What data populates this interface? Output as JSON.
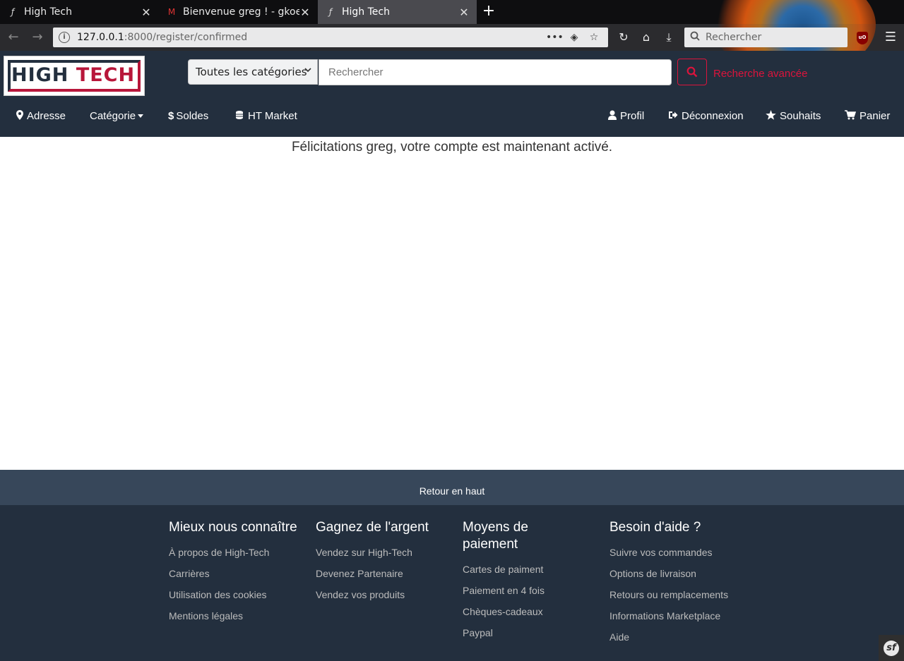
{
  "browser": {
    "tabs": [
      {
        "title": "High Tech",
        "active": false
      },
      {
        "title": "Bienvenue greg ! - gkoer",
        "active": false
      },
      {
        "title": "High Tech",
        "active": true
      }
    ],
    "url_host": "127.0.0.1",
    "url_rest": ":8000/register/confirmed",
    "search_placeholder": "Rechercher"
  },
  "header": {
    "logo_left": "HIGH",
    "logo_right": "TECH",
    "category_select": "Toutes les catégories",
    "search_placeholder": "Rechercher",
    "advanced_search": "Recherche avancée"
  },
  "nav": {
    "address": "Adresse",
    "category": "Catégorie",
    "sales": "Soldes",
    "market": "HT Market",
    "profile": "Profil",
    "logout": "Déconnexion",
    "wishlist": "Souhaits",
    "cart": "Panier"
  },
  "main": {
    "message": "Félicitations greg, votre compte est maintenant activé."
  },
  "footer": {
    "back_to_top": "Retour en haut",
    "columns": [
      {
        "title": "Mieux nous connaître",
        "links": [
          "À propos de High-Tech",
          "Carrières",
          "Utilisation des cookies",
          "Mentions légales"
        ]
      },
      {
        "title": "Gagnez de l'argent",
        "links": [
          "Vendez sur High-Tech",
          "Devenez Partenaire",
          "Vendez vos produits"
        ]
      },
      {
        "title": "Moyens de paiement",
        "links": [
          "Cartes de paiment",
          "Paiement en 4 fois",
          "Chèques-cadeaux",
          "Paypal"
        ]
      },
      {
        "title": "Besoin d'aide ?",
        "links": [
          "Suivre vos commandes",
          "Options de livraison",
          "Retours ou remplacements",
          "Informations Marketplace",
          "Aide"
        ]
      }
    ]
  },
  "colors": {
    "header_bg": "#232f3e",
    "backtop_bg": "#37475a",
    "accent": "#dc143c"
  }
}
